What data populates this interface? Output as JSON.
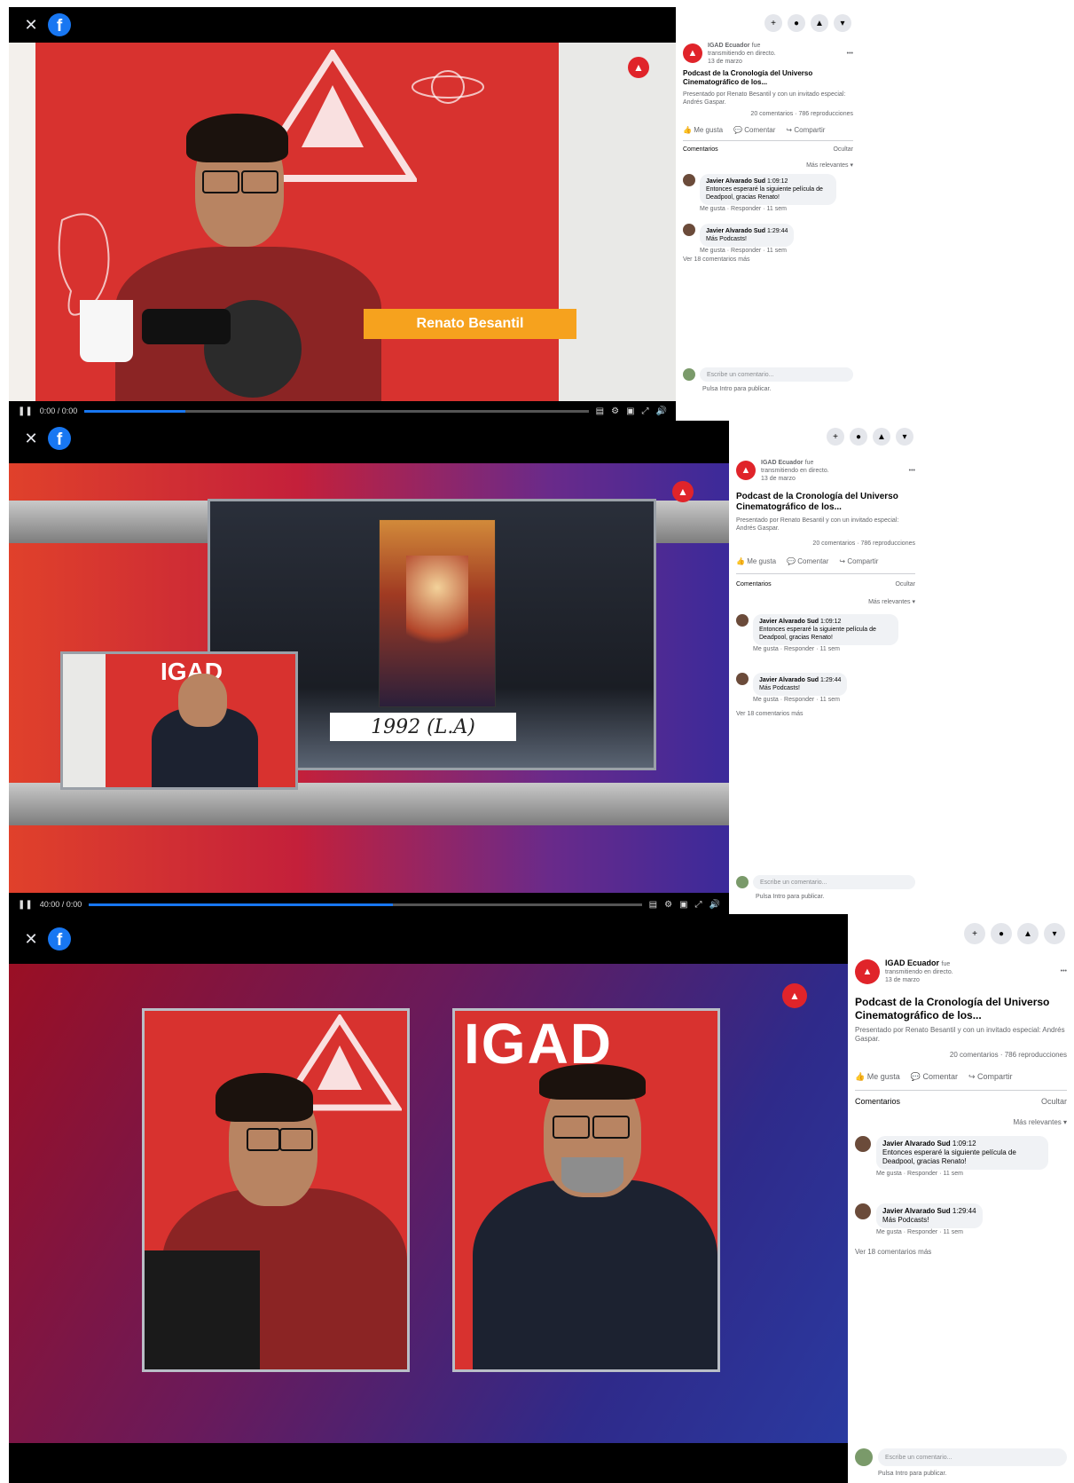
{
  "shots": [
    {
      "time": "0:00 / 0:00",
      "lower_third": "Renato Besantil",
      "page_name": "IGAD Ecuador",
      "page_suffix": "fue",
      "page_sub": "transmitiendo en directo.",
      "page_time": "13 de marzo",
      "post_title": "Podcast de la Cronología del Universo Cinematográfico de los...",
      "post_desc": "Presentado por Renato Besantil y con un invitado especial: Andrés Gaspar.",
      "stats": "20 comentarios · 786 reproducciones",
      "like": "Me gusta",
      "comment": "Comentar",
      "share": "Compartir",
      "comments_label": "Comentarios",
      "hide_label": "Ocultar",
      "sort_label": "Más relevantes ▾",
      "comments": [
        {
          "name": "Javier Alvarado Sud",
          "time": "1:09:12",
          "text": "Entonces esperaré la siguiente película de Deadpool, gracias Renato!",
          "meta": "Me gusta · Responder · 11 sem"
        },
        {
          "name": "Javier Alvarado Sud",
          "time": "1:29:44",
          "text": "Más Podcasts!",
          "meta": "Me gusta · Responder · 11 sem"
        }
      ],
      "more_comments": "Ver 18 comentarios más",
      "input_placeholder": "Escribe un comentario...",
      "input_hint": "Pulsa Intro para publicar."
    },
    {
      "time": "40:00 / 0:00",
      "handwriting": "1992 (L.A)",
      "inset_logo": "IGAD",
      "page_name": "IGAD Ecuador",
      "page_suffix": "fue",
      "page_sub": "transmitiendo en directo.",
      "page_time": "13 de marzo",
      "post_title": "Podcast de la Cronología del Universo Cinematográfico de los...",
      "post_desc": "Presentado por Renato Besantil y con un invitado especial: Andrés Gaspar.",
      "stats": "20 comentarios · 786 reproducciones",
      "like": "Me gusta",
      "comment": "Comentar",
      "share": "Compartir",
      "comments_label": "Comentarios",
      "hide_label": "Ocultar",
      "sort_label": "Más relevantes ▾",
      "comments": [
        {
          "name": "Javier Alvarado Sud",
          "time": "1:09:12",
          "text": "Entonces esperaré la siguiente película de Deadpool, gracias Renato!",
          "meta": "Me gusta · Responder · 11 sem"
        },
        {
          "name": "Javier Alvarado Sud",
          "time": "1:29:44",
          "text": "Más Podcasts!",
          "meta": "Me gusta · Responder · 11 sem"
        }
      ],
      "more_comments": "Ver 18 comentarios más",
      "input_placeholder": "Escribe un comentario...",
      "input_hint": "Pulsa Intro para publicar."
    },
    {
      "logo": "IGAD",
      "page_name": "IGAD Ecuador",
      "page_suffix": "fue",
      "page_sub": "transmitiendo en directo.",
      "page_time": "13 de marzo",
      "post_title": "Podcast de la Cronología del Universo Cinematográfico de los...",
      "post_desc": "Presentado por Renato Besantil y con un invitado especial: Andrés Gaspar.",
      "stats": "20 comentarios · 786 reproducciones",
      "like": "Me gusta",
      "comment": "Comentar",
      "share": "Compartir",
      "comments_label": "Comentarios",
      "hide_label": "Ocultar",
      "sort_label": "Más relevantes ▾",
      "comments": [
        {
          "name": "Javier Alvarado Sud",
          "time": "1:09:12",
          "text": "Entonces esperaré la siguiente película de Deadpool, gracias Renato!",
          "meta": "Me gusta · Responder · 11 sem"
        },
        {
          "name": "Javier Alvarado Sud",
          "time": "1:29:44",
          "text": "Más Podcasts!",
          "meta": "Me gusta · Responder · 11 sem"
        }
      ],
      "more_comments": "Ver 18 comentarios más",
      "input_placeholder": "Escribe un comentario...",
      "input_hint": "Pulsa Intro para publicar."
    }
  ],
  "progress": [
    0.2,
    0.55
  ],
  "icons": {
    "close": "close-icon",
    "facebook": "facebook-icon",
    "add": "plus-icon",
    "messenger": "messenger-icon",
    "notifications": "bell-icon",
    "account": "account-icon"
  }
}
